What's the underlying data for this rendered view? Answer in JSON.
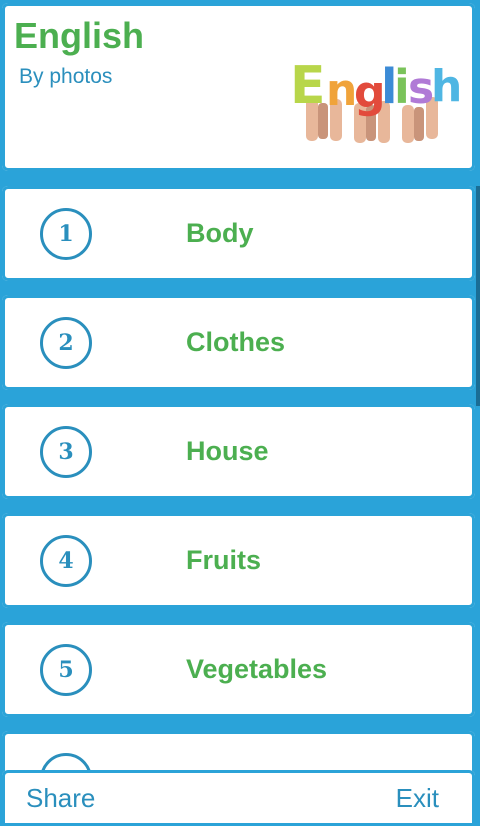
{
  "header": {
    "title": "English",
    "subtitle": "By photos",
    "logo_text": "English"
  },
  "lessons": [
    {
      "number": "1",
      "label": "Body"
    },
    {
      "number": "2",
      "label": "Clothes"
    },
    {
      "number": "3",
      "label": "House"
    },
    {
      "number": "4",
      "label": "Fruits"
    },
    {
      "number": "5",
      "label": "Vegetables"
    }
  ],
  "footer": {
    "share_label": "Share",
    "exit_label": "Exit"
  },
  "colors": {
    "accent_blue": "#2ba3d8",
    "title_green": "#4caf50"
  }
}
